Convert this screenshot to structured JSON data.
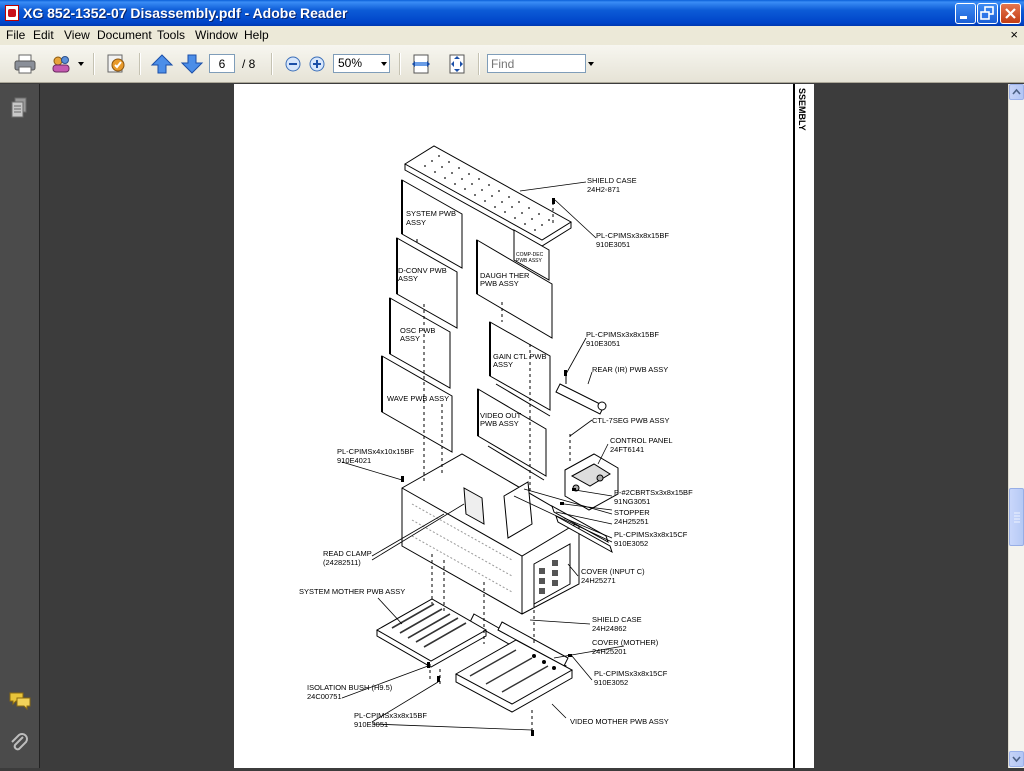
{
  "window": {
    "title": "XG 852-1352-07  Disassembly.pdf - Adobe Reader"
  },
  "menu": {
    "items": [
      "File",
      "Edit",
      "View",
      "Document",
      "Tools",
      "Window",
      "Help"
    ],
    "close_glyph": "×"
  },
  "toolbar": {
    "current_page": "6",
    "total_pages": "/ 8",
    "zoom": "50%",
    "find_placeholder": "Find"
  },
  "document": {
    "side_heading": "SSEMBLY",
    "labels": {
      "shield_case_top": "SHIELD CASE",
      "shield_case_top_pn": "24H2◦871",
      "screw_top": "PL-CPIMSx3x8x15BF",
      "screw_top_pn": "910E3051",
      "system_pwb": "SYSTEM PWB",
      "system_pwb_2": "ASSY",
      "comp_dec": "COMP-DEC",
      "comp_dec_2": "PWB ASSY",
      "dconv": "D-CONV PWB",
      "dconv_2": "ASSY",
      "daughter": "DAUGH THER",
      "daughter_2": "PWB ASSY",
      "osc": "OSC PWB",
      "osc_2": "ASSY",
      "screw_mid": "PL-CPIMSx3x8x15BF",
      "screw_mid_pn": "910E3051",
      "gainctl": "GAIN CTL PWB",
      "gainctl_2": "ASSY",
      "rear_ir": "REAR (IR) PWB ASSY",
      "wave": "WAVE PWB ASSY",
      "videoout": "VIDEO OUT",
      "videoout_2": "PWB ASSY",
      "ctl7seg": "CTL-7SEG PWB ASSY",
      "screw_left": "PL-CPIMSx4x10x15BF",
      "screw_left_pn": "910E4021",
      "control_panel": "CONTROL PANEL",
      "control_panel_pn": "24FT6141",
      "p2cbrt": "P-#2CBRTSx3x8x15BF",
      "p2cbrt_pn": "91NG3051",
      "stopper": "STOPPER",
      "stopper_pn": "24H25251",
      "screw_cf": "PL-CPIMSx3x8x15CF",
      "screw_cf_pn": "910E3052",
      "read_clamp": "READ CLAMP",
      "read_clamp_pn": "(24282511)",
      "cover_input": "COVER (INPUT C)",
      "cover_input_pn": "24H25271",
      "sys_mother": "SYSTEM MOTHER PWB ASSY",
      "shield_case_bot": "SHIELD CASE",
      "shield_case_bot_pn": "24H24862",
      "cover_mother": "COVER (MOTHER)",
      "cover_mother_pn": "24H25201",
      "screw_cf2": "PL-CPIMSx3x8x15CF",
      "screw_cf2_pn": "910E3052",
      "isolation": "ISOLATION BUSH (H9.5)",
      "isolation_pn": "24C00751",
      "screw_bot": "PL-CPIMSx3x8x15BF",
      "screw_bot_pn": "910E3051",
      "video_mother": "VIDEO MOTHER PWB ASSY"
    }
  }
}
